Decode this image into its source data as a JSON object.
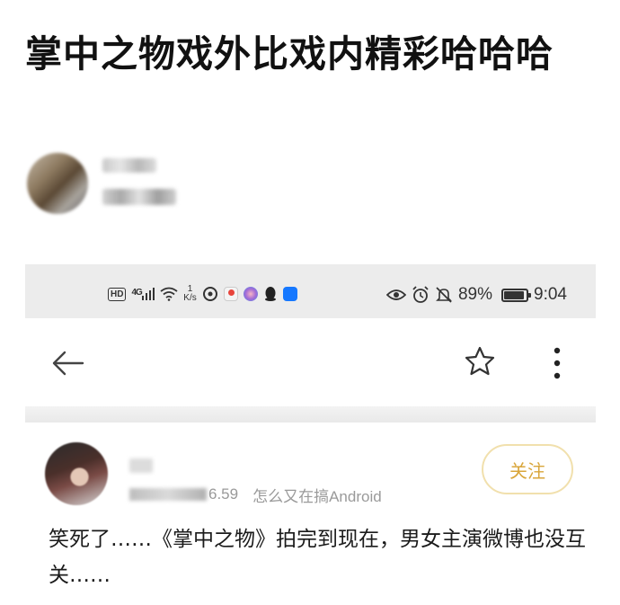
{
  "post": {
    "title": "掌中之物戏外比戏内精彩哈哈哈"
  },
  "screenshot": {
    "status_bar": {
      "hd": "HD",
      "network": "4G",
      "speed_value": "1",
      "speed_unit": "K/s",
      "battery": "89%",
      "time": "9:04",
      "icons": [
        "hd-icon",
        "signal-icon",
        "wifi-icon",
        "netease-icon",
        "maps-icon",
        "app-icon",
        "qq-icon",
        "alipay-icon",
        "eye-icon",
        "alarm-icon",
        "mute-icon",
        "battery-icon"
      ]
    },
    "toolbar": {
      "icons": [
        "back-arrow-icon",
        "star-icon",
        "more-vertical-icon"
      ]
    },
    "comment": {
      "meta_partial": "6.59",
      "source": "怎么又在搞Android",
      "follow_label": "关注",
      "text": "笑死了……《掌中之物》拍完到现在，男女主演微博也没互关……"
    }
  },
  "colors": {
    "follow_text": "#d9a63b",
    "follow_border": "#f1e0ad",
    "status_bar_bg": "#ececec",
    "meta_gray": "#9a9a9a"
  }
}
